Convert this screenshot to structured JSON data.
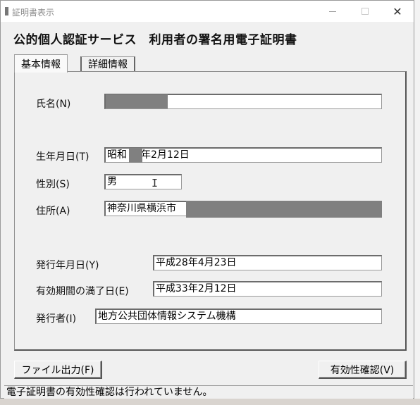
{
  "window": {
    "title": "証明書表示"
  },
  "heading": "公的個人認証サービス　利用者の署名用電子証明書",
  "tabs": [
    {
      "label": "基本情報",
      "active": true
    },
    {
      "label": "詳細情報",
      "active": false
    }
  ],
  "fields": {
    "name": {
      "label": "氏名(N)",
      "value": ""
    },
    "birth": {
      "label": "生年月日(T)",
      "value_prefix": "昭和",
      "value_suffix": "年2月12日"
    },
    "gender": {
      "label": "性別(S)",
      "value": "男"
    },
    "address": {
      "label": "住所(A)",
      "value": "神奈川県横浜市"
    },
    "issue_date": {
      "label": "発行年月日(Y)",
      "value": "平成28年4月23日"
    },
    "expiry_date": {
      "label": "有効期間の満了日(E)",
      "value": "平成33年2月12日"
    },
    "issuer": {
      "label": "発行者(I)",
      "value": "地方公共団体情報システム機構"
    }
  },
  "buttons": {
    "file_output": "ファイル出力(F)",
    "validity_check": "有効性確認(V)"
  },
  "status": "電子証明書の有効性確認は行われていません。",
  "colors": {
    "redaction": "#808080",
    "window_bg": "#f0f0f0"
  }
}
